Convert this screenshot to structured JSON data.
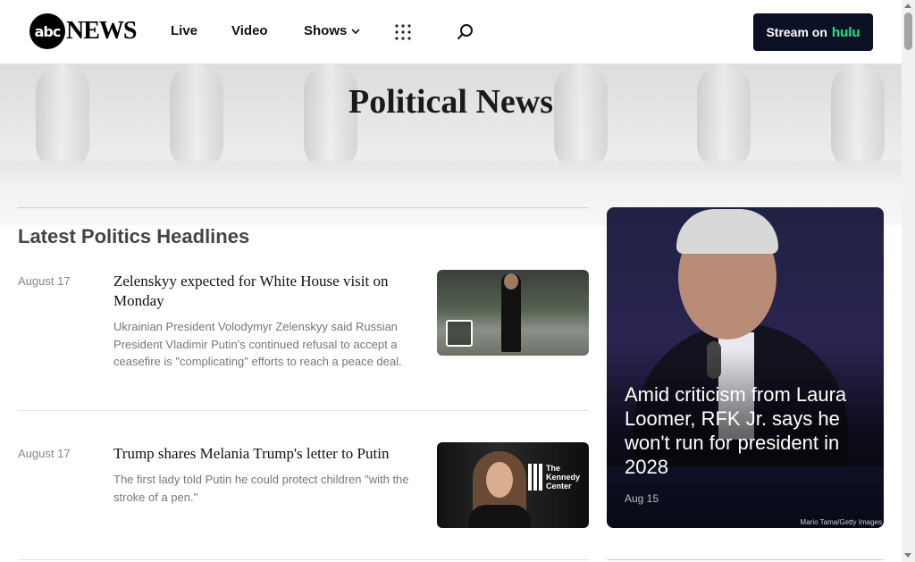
{
  "header": {
    "logo_mark": "abc",
    "logo_text": "NEWS",
    "nav": {
      "live": "Live",
      "video": "Video",
      "shows": "Shows"
    },
    "stream_label": "Stream on",
    "stream_brand": "hulu"
  },
  "hero": {
    "title": "Political News"
  },
  "section": {
    "title": "Latest Politics Headlines"
  },
  "articles": [
    {
      "date": "August 17",
      "title": "Zelenskyy expected for White House visit on Monday",
      "description": "Ukrainian President Volodymyr Zelenskyy said Russian President Vladimir Putin's continued refusal to accept a ceasefire is \"complicating\" efforts to reach a peace deal."
    },
    {
      "date": "August 17",
      "title": "Trump shares Melania Trump's letter to Putin",
      "description": "The first lady told Putin he could protect children \"with the stroke of a pen.\"",
      "thumb_text": "The Kennedy Center"
    }
  ],
  "feature": {
    "title": "Amid criticism from Laura Loomer, RFK Jr. says he won't run for president in 2028",
    "date": "Aug 15",
    "credit": "Mario Tama/Getty Images"
  },
  "colors": {
    "stream_bg": "#0b1024",
    "hulu_green": "#1ce783"
  }
}
